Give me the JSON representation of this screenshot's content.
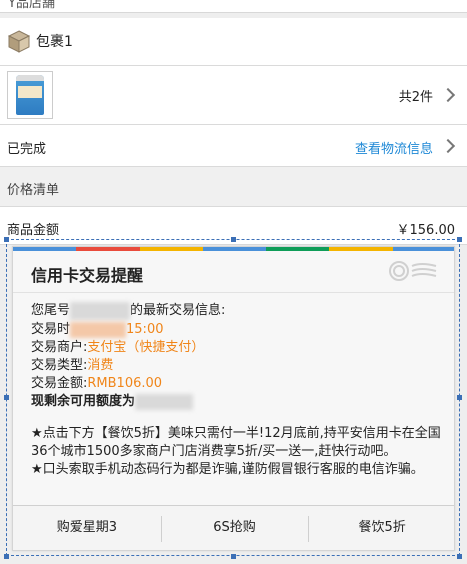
{
  "order": {
    "store_label": "Y品店舗",
    "package": {
      "label": "包裹1",
      "icon": "package-icon"
    },
    "product": {
      "count_text": "共2件",
      "thumbnail": "milk-powder-can"
    },
    "status": {
      "text": "已完成",
      "logistics_link": "查看物流信息"
    },
    "price_section": {
      "title": "价格清单"
    },
    "goods_amount": {
      "label": "商品金额",
      "value": "￥156.00"
    }
  },
  "notification": {
    "title": "信用卡交易提醒",
    "logo_icon": "card-signal-logo",
    "intro_prefix": "您尾号",
    "intro_suffix": "的最新交易信息:",
    "time_label": "交易时",
    "time_value": "15:00",
    "merchant_label": "交易商户:",
    "merchant_value": "支付宝（快捷支付）",
    "type_label": "交易类型:",
    "type_value": "消费",
    "amount_label": "交易金额:",
    "amount_value": "RMB106.00",
    "available_label": "现剩余可用额度为",
    "promo_1": "★点击下方【餐饮5折】美味只需付一半!12月底前,持平安信用卡在全国36个城市1500多家商户门店消费享5折/买一送一,赶快行动吧。",
    "promo_2": "★口头索取手机动态码行为都是诈骗,谨防假冒银行客服的电信诈骗。",
    "actions": [
      "购爱星期3",
      "6S抢购",
      "餐饮5折"
    ],
    "colors": {
      "highlight": "#f08519",
      "link": "#1e88d6",
      "frame": "#3b6fb6"
    }
  }
}
